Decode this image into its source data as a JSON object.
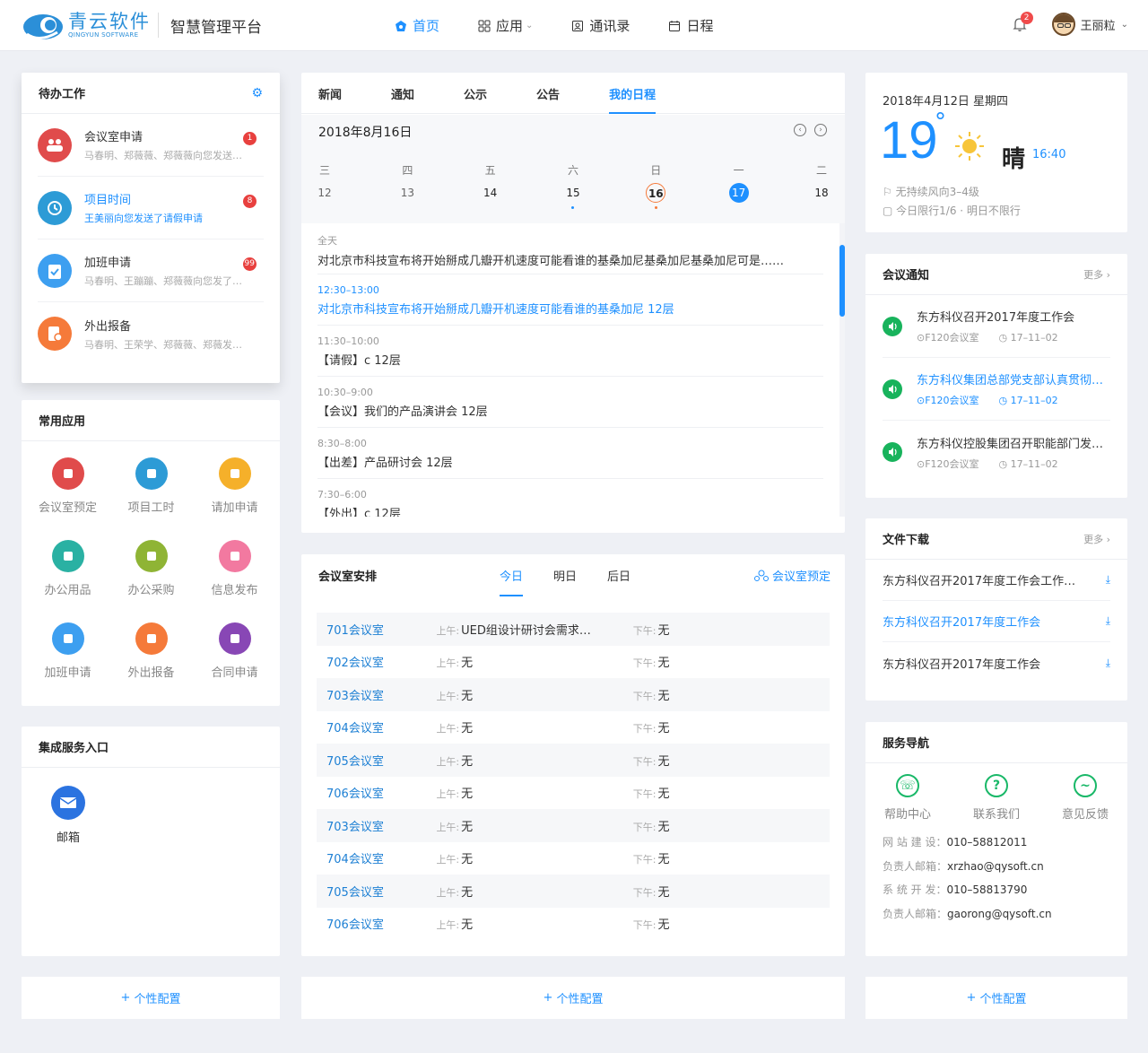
{
  "header": {
    "brand_cn": "青云软件",
    "brand_en": "QINGYUN SOFTWARE",
    "platform": "智慧管理平台",
    "nav": [
      {
        "label": "首页"
      },
      {
        "label": "应用"
      },
      {
        "label": "通讯录"
      },
      {
        "label": "日程"
      }
    ],
    "notif_count": "2",
    "user": "王丽粒"
  },
  "todo": {
    "title": "待办工作",
    "items": [
      {
        "title": "会议室申请",
        "sub": "马春明、郑薇薇、郑薇薇向您发送…",
        "badge": "1",
        "color": "#e04b4b"
      },
      {
        "title": "项目时间",
        "sub": "王美丽向您发送了请假申请",
        "badge": "8",
        "color": "#2d9bd6"
      },
      {
        "title": "加班申请",
        "sub": "马春明、王蹦蹦、郑薇薇向您发了…",
        "badge": "99",
        "color": "#3d9ff0"
      },
      {
        "title": "外出报备",
        "sub": "马春明、王荣学、郑薇薇、郑薇发…",
        "badge": "",
        "color": "#f57a3a"
      }
    ]
  },
  "apps": {
    "title": "常用应用",
    "items": [
      {
        "label": "会议室预定",
        "color": "#e04b4b",
        "icon": "people-icon"
      },
      {
        "label": "项目工时",
        "color": "#2d9bd6",
        "icon": "clock-icon"
      },
      {
        "label": "请加申请",
        "color": "#f5b02a",
        "icon": "leave-icon"
      },
      {
        "label": "办公用品",
        "color": "#2ab1a3",
        "icon": "printer-icon"
      },
      {
        "label": "办公采购",
        "color": "#8fb435",
        "icon": "basket-icon"
      },
      {
        "label": "信息发布",
        "color": "#f279a0",
        "icon": "doc-icon"
      },
      {
        "label": "加班申请",
        "color": "#3d9ff0",
        "icon": "clipboard-icon"
      },
      {
        "label": "外出报备",
        "color": "#f57a3a",
        "icon": "report-icon"
      },
      {
        "label": "合同申请",
        "color": "#8847b5",
        "icon": "stamp-icon"
      }
    ]
  },
  "integration": {
    "title": "集成服务入口",
    "items": [
      {
        "label": "邮箱"
      }
    ]
  },
  "schedule": {
    "tabs": [
      "新闻",
      "通知",
      "公示",
      "公告",
      "我的日程"
    ],
    "date": "2018年8月16日",
    "week": [
      {
        "w": "三",
        "d": "12"
      },
      {
        "w": "四",
        "d": "13"
      },
      {
        "w": "五",
        "d": "14"
      },
      {
        "w": "六",
        "d": "15"
      },
      {
        "w": "日",
        "d": "16"
      },
      {
        "w": "一",
        "d": "17"
      },
      {
        "w": "二",
        "d": "18"
      }
    ],
    "events": [
      {
        "time": "全天",
        "text": "对北京市科技宣布将开始掰成几瓣开机速度可能看谁的基桑加尼基桑加尼基桑加尼可是……"
      },
      {
        "time": "12:30–13:00",
        "text": "对北京市科技宣布将开始掰成几瓣开机速度可能看谁的基桑加尼   12层"
      },
      {
        "time": "11:30–10:00",
        "text": "【请假】c   12层"
      },
      {
        "time": "10:30–9:00",
        "text": "【会议】我们的产品演讲会   12层"
      },
      {
        "time": "8:30–8:00",
        "text": "【出差】产品研讨会   12层"
      },
      {
        "time": "7:30–6:00",
        "text": "【外出】c   12层"
      }
    ]
  },
  "rooms": {
    "title": "会议室安排",
    "tabs": [
      "今日",
      "明日",
      "后日"
    ],
    "book": "会议室预定",
    "am": "上午:",
    "pm": "下午:",
    "rows": [
      {
        "name": "701会议室",
        "am": "UED组设计研讨会需求…",
        "pm": "无"
      },
      {
        "name": "702会议室",
        "am": "无",
        "pm": "无"
      },
      {
        "name": "703会议室",
        "am": "无",
        "pm": "无"
      },
      {
        "name": "704会议室",
        "am": "无",
        "pm": "无"
      },
      {
        "name": "705会议室",
        "am": "无",
        "pm": "无"
      },
      {
        "name": "706会议室",
        "am": "无",
        "pm": "无"
      },
      {
        "name": "703会议室",
        "am": "无",
        "pm": "无"
      },
      {
        "name": "704会议室",
        "am": "无",
        "pm": "无"
      },
      {
        "name": "705会议室",
        "am": "无",
        "pm": "无"
      },
      {
        "name": "706会议室",
        "am": "无",
        "pm": "无"
      }
    ]
  },
  "weather": {
    "date": "2018年4月12日  星期四",
    "temp": "19",
    "deg": "°",
    "cond": "晴",
    "time": "16:40",
    "wind": "无持续风向3–4级",
    "limit": "今日限行1/6 · 明日不限行"
  },
  "meetings": {
    "title": "会议通知",
    "more": "更多",
    "items": [
      {
        "title": "东方科仪召开2017年度工作会",
        "room": "F120会议室",
        "date": "17–11–02"
      },
      {
        "title": "东方科仪集团总部党支部认真贯彻…",
        "room": "F120会议室",
        "date": "17–11–02"
      },
      {
        "title": "东方科仪控股集团召开职能部门发…",
        "room": "F120会议室",
        "date": "17–11–02"
      }
    ]
  },
  "files": {
    "title": "文件下载",
    "more": "更多",
    "items": [
      {
        "name": "东方科仪召开2017年度工作会工作…"
      },
      {
        "name": "东方科仪召开2017年度工作会"
      },
      {
        "name": "东方科仪召开2017年度工作会"
      }
    ]
  },
  "service": {
    "title": "服务导航",
    "items": [
      {
        "label": "帮助中心"
      },
      {
        "label": "联系我们"
      },
      {
        "label": "意见反馈"
      }
    ],
    "info": [
      {
        "label": "网 站 建 设：",
        "value": "010–58812011"
      },
      {
        "label": "负责人邮箱：",
        "value": "xrzhao@qysoft.cn"
      },
      {
        "label": "系 统 开 发：",
        "value": "010–58813790"
      },
      {
        "label": "负责人邮箱：",
        "value": "gaorong@qysoft.cn"
      }
    ]
  },
  "config_label": "个性配置"
}
